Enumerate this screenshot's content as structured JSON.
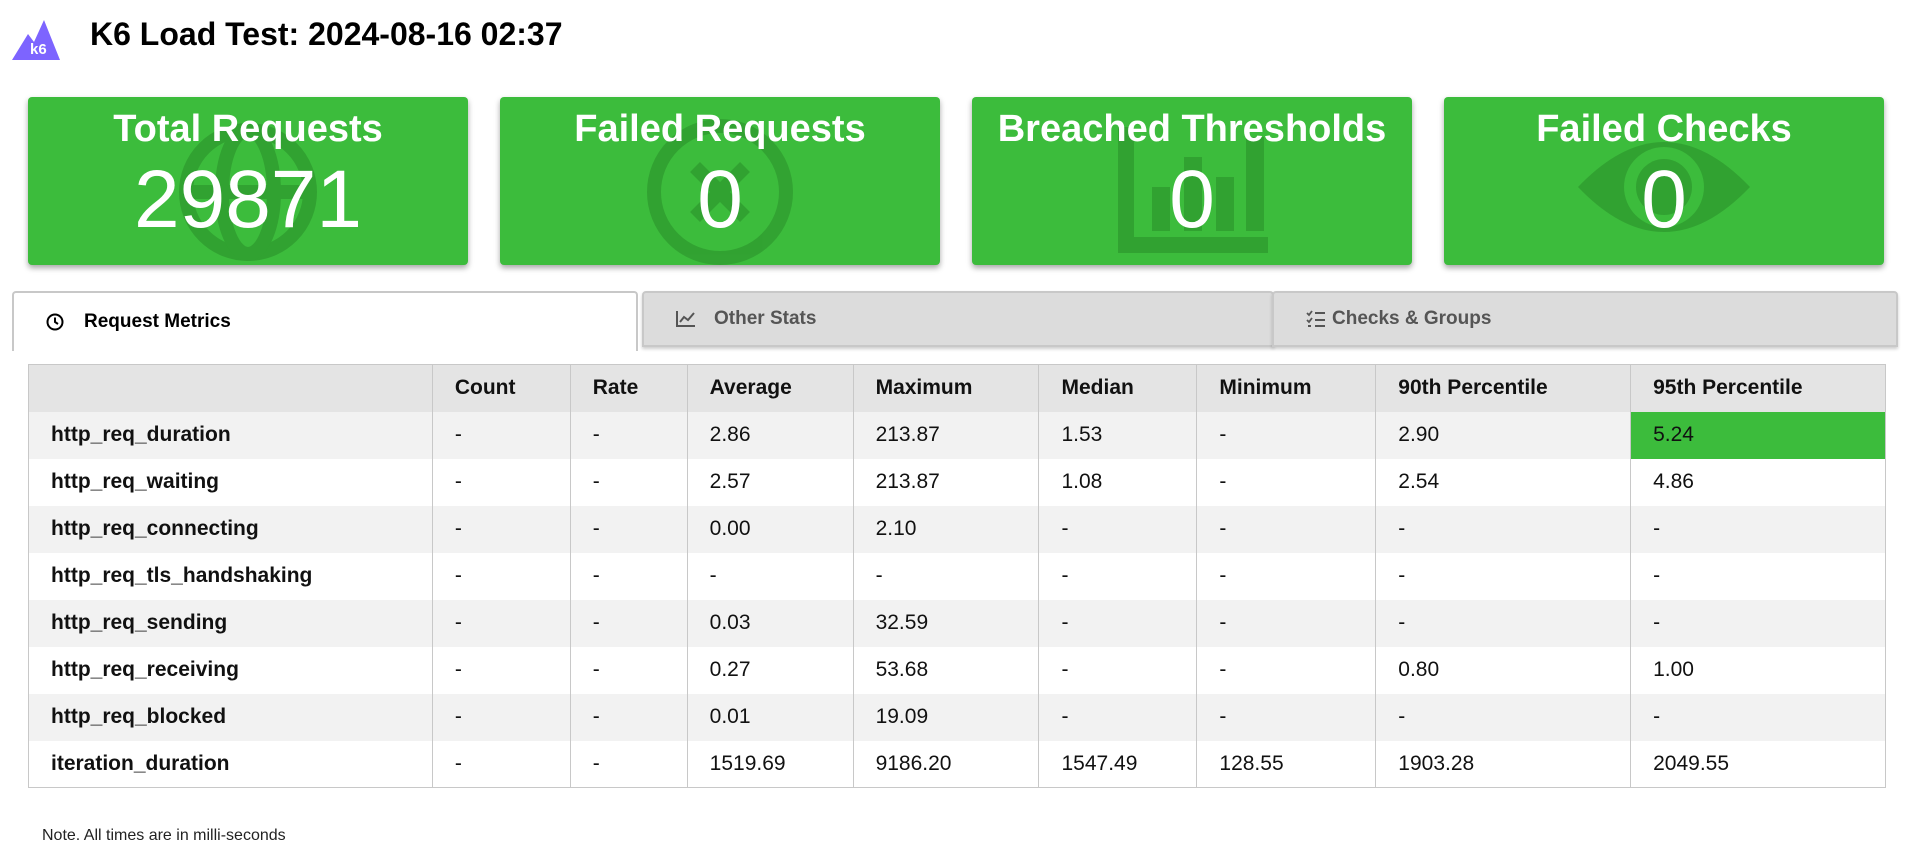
{
  "header": {
    "logo_text": "k6",
    "title": "K6 Load Test: 2024-08-16 02:37"
  },
  "cards": [
    {
      "title": "Total Requests",
      "value": "29871",
      "icon": "globe-icon"
    },
    {
      "title": "Failed Requests",
      "value": "0",
      "icon": "x-circle-icon"
    },
    {
      "title": "Breached Thresholds",
      "value": "0",
      "icon": "bar-chart-icon"
    },
    {
      "title": "Failed Checks",
      "value": "0",
      "icon": "eye-icon"
    }
  ],
  "tabs": [
    {
      "label": "Request Metrics",
      "icon": "clock-icon",
      "active": true
    },
    {
      "label": "Other Stats",
      "icon": "line-chart-icon",
      "active": false
    },
    {
      "label": "Checks & Groups",
      "icon": "checklist-icon",
      "active": false
    }
  ],
  "table": {
    "headers": [
      "",
      "Count",
      "Rate",
      "Average",
      "Maximum",
      "Median",
      "Minimum",
      "90th Percentile",
      "95th Percentile"
    ],
    "rows": [
      [
        "http_req_duration",
        "-",
        "-",
        "2.86",
        "213.87",
        "1.53",
        "-",
        "2.90",
        "5.24"
      ],
      [
        "http_req_waiting",
        "-",
        "-",
        "2.57",
        "213.87",
        "1.08",
        "-",
        "2.54",
        "4.86"
      ],
      [
        "http_req_connecting",
        "-",
        "-",
        "0.00",
        "2.10",
        "-",
        "-",
        "-",
        "-"
      ],
      [
        "http_req_tls_handshaking",
        "-",
        "-",
        "-",
        "-",
        "-",
        "-",
        "-",
        "-"
      ],
      [
        "http_req_sending",
        "-",
        "-",
        "0.03",
        "32.59",
        "-",
        "-",
        "-",
        "-"
      ],
      [
        "http_req_receiving",
        "-",
        "-",
        "0.27",
        "53.68",
        "-",
        "-",
        "0.80",
        "1.00"
      ],
      [
        "http_req_blocked",
        "-",
        "-",
        "0.01",
        "19.09",
        "-",
        "-",
        "-",
        "-"
      ],
      [
        "iteration_duration",
        "-",
        "-",
        "1519.69",
        "9186.20",
        "1547.49",
        "128.55",
        "1903.28",
        "2049.55"
      ]
    ]
  },
  "note": "Note. All times are in milli-seconds",
  "colors": {
    "accent": "#3cbc3c",
    "logo": "#7d64ff",
    "threshold_pass": "#3cbc3c"
  }
}
